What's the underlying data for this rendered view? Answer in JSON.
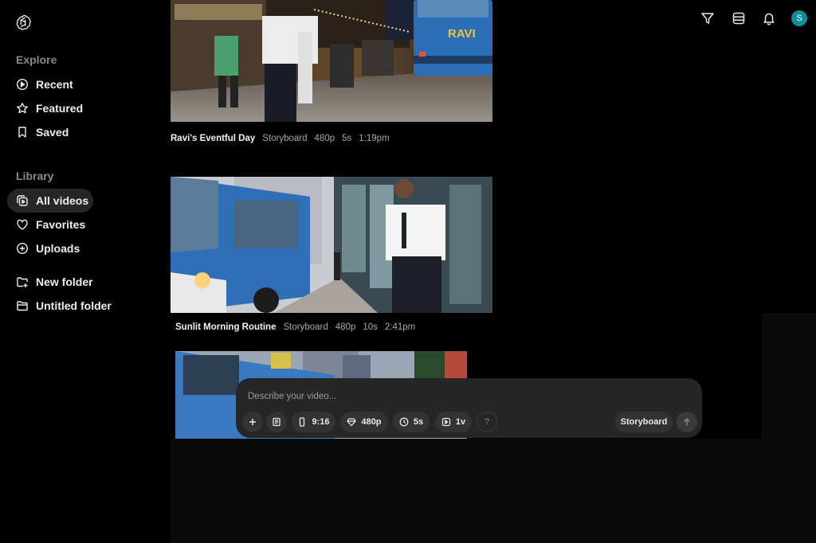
{
  "sidebar": {
    "explore_title": "Explore",
    "explore_items": [
      {
        "label": "Recent",
        "icon": "play-circle-icon"
      },
      {
        "label": "Featured",
        "icon": "star-icon"
      },
      {
        "label": "Saved",
        "icon": "bookmark-icon"
      }
    ],
    "library_title": "Library",
    "library_items": [
      {
        "label": "All videos",
        "icon": "videos-icon",
        "active": true
      },
      {
        "label": "Favorites",
        "icon": "heart-icon"
      },
      {
        "label": "Uploads",
        "icon": "plus-circle-icon"
      }
    ],
    "folders": [
      {
        "label": "New folder",
        "icon": "new-folder-icon"
      },
      {
        "label": "Untitled folder",
        "icon": "folder-icon"
      }
    ]
  },
  "topbar": {
    "icons": [
      "filter-icon",
      "layout-icon",
      "bell-icon"
    ],
    "avatar_initial": "S",
    "avatar_color": "#0e8f9a"
  },
  "videos": [
    {
      "title": "Ravi's Eventful Day",
      "type": "Storyboard",
      "resolution": "480p",
      "duration": "5s",
      "time": "1:19pm"
    },
    {
      "title": "Sunlit Morning Routine",
      "type": "Storyboard",
      "resolution": "480p",
      "duration": "10s",
      "time": "2:41pm"
    },
    {
      "title": "",
      "type": "",
      "resolution": "",
      "duration": "",
      "time": ""
    }
  ],
  "thumb_text": {
    "bus_sign": "RAVI"
  },
  "composer": {
    "placeholder": "Describe your video...",
    "aspect": "9:16",
    "resolution": "480p",
    "duration": "5s",
    "variations": "1v",
    "help": "?",
    "mode": "Storyboard"
  }
}
